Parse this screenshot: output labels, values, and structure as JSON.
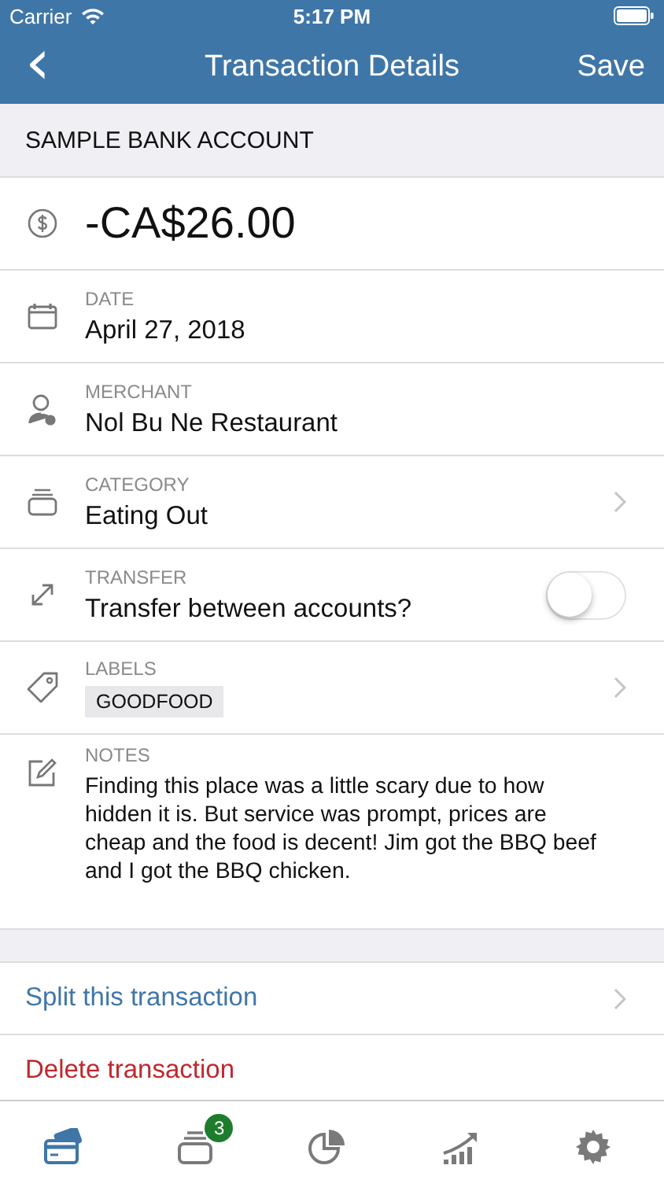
{
  "status_bar": {
    "carrier": "Carrier",
    "time": "5:17 PM"
  },
  "nav": {
    "back": "‹",
    "title": "Transaction Details",
    "action": "Save"
  },
  "account": "SAMPLE BANK ACCOUNT",
  "rows": [
    {
      "kind": "amount",
      "value": "-CA$26.00",
      "disclosure": false
    },
    {
      "kind": "value",
      "label": "DATE",
      "value": "April 27, 2018",
      "disclosure": false
    },
    {
      "kind": "value",
      "label": "MERCHANT",
      "value": "Nol Bu Ne Restaurant",
      "disclosure": false
    },
    {
      "kind": "value",
      "label": "CATEGORY",
      "value": "Eating Out",
      "disclosure": true
    },
    {
      "kind": "toggle",
      "label": "TRANSFER",
      "value": "Transfer between accounts?",
      "on": false,
      "disclosure": false
    },
    {
      "kind": "tags",
      "label": "LABELS",
      "tags": [
        "GOODFOOD"
      ],
      "disclosure": true
    },
    {
      "kind": "notes",
      "label": "NOTES",
      "value": "Finding this place was a little scary due to how hidden it is. But service was prompt, prices are cheap and the food is decent! Jim got the BBQ beef and I got the BBQ chicken.",
      "disclosure": false
    }
  ],
  "actions": [
    {
      "kind": "link",
      "label": "Split this transaction",
      "disclosure": true
    },
    {
      "kind": "danger",
      "label": "Delete transaction",
      "disclosure": false
    }
  ],
  "tab_bar": [
    {
      "selected": true
    },
    {
      "selected": false,
      "badge": "3"
    },
    {
      "selected": false
    },
    {
      "selected": false
    },
    {
      "selected": false
    }
  ]
}
